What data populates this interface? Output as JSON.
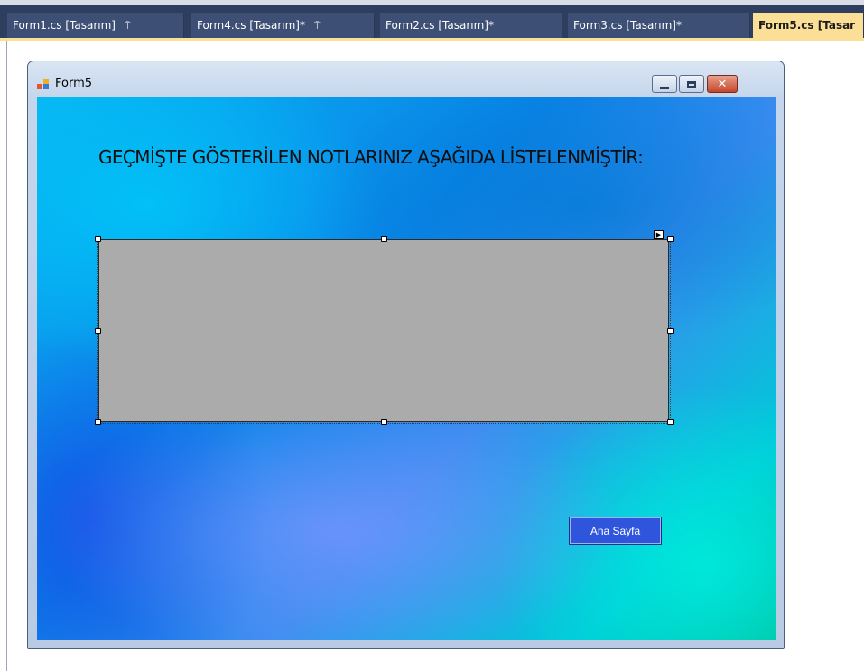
{
  "ide": {
    "tabs": [
      {
        "label": "Form1.cs [Tasarım]",
        "pinned": true,
        "active": false
      },
      {
        "label": "Form4.cs [Tasarım]*",
        "pinned": true,
        "active": false
      },
      {
        "label": "Form2.cs [Tasarım]*",
        "pinned": false,
        "active": false
      },
      {
        "label": "Form3.cs [Tasarım]*",
        "pinned": false,
        "active": false
      },
      {
        "label": "Form5.cs [Tasar",
        "pinned": false,
        "active": true
      }
    ],
    "pin_glyph": "⍑",
    "colors": {
      "tab_bg": "#3d4f74",
      "active_tab_bg": "#fcdf97"
    }
  },
  "form": {
    "title": "Form5",
    "icon": "form-window-icon",
    "caption_buttons": [
      "minimize",
      "maximize",
      "close"
    ],
    "close_glyph": "✕",
    "heading": "GEÇMİŞTE GÖSTERİLEN NOTLARINIZ AŞAĞIDA LİSTELENMİŞTİR:",
    "home_button_label": "Ana Sayfa",
    "smart_tag_glyph": "▶",
    "colors": {
      "button_bg": "#2f55dc",
      "grid_bg": "#ababab"
    }
  }
}
